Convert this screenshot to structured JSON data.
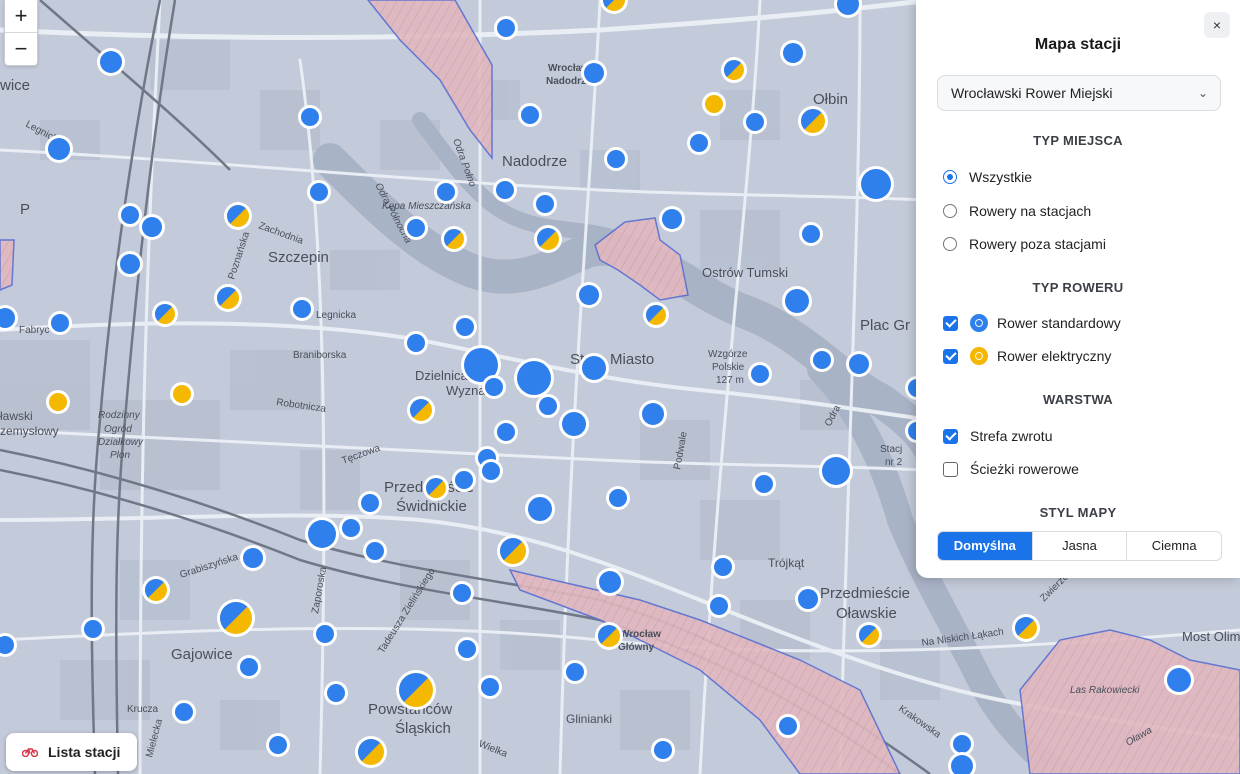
{
  "map": {
    "labels": {
      "szczepin": "Szczepin",
      "nadodrze": "Nadodrze",
      "olbin": "Ołbin",
      "ostrow_tumski": "Ostrów Tumski",
      "kepa": "Kępa Mieszczańska",
      "plac_gr": "Plac Gr",
      "stare_miasto": "Stare Miasto",
      "dzielnica": "Dzielnica",
      "wyznan": "Wyznań",
      "przedmiescie_swidnickie_1": "Przedmieście",
      "przedmiescie_swidnickie_2": "Świdnickie",
      "gajowice": "Gajowice",
      "powstancow_1": "Powstańców",
      "powstancow_2": "Śląskich",
      "przedmiescie_olawskie_1": "Przedmieście",
      "przedmiescie_olawskie_2": "Oławskie",
      "trojkat": "Trójkąt",
      "glinianki": "Glinianki",
      "most_olim": "Most Olim",
      "las_rakowiecki": "Las Rakowiecki",
      "wzgorze_1": "Wzgórze",
      "wzgorze_2": "Polskie",
      "wzgorze_3": "127 m",
      "rodzinny_1": "Rodzinny",
      "rodzinny_2": "Ogród",
      "rodzinny_3": "Działkowy",
      "rodzinny_4": "Plon",
      "wroclaw_nad_1": "Wrocław",
      "wroclaw_nad_2": "Nadodrz",
      "wroclaw_gl_1": "Wrocław",
      "wroclaw_gl_2": "Główny",
      "olawski_1": "ławski",
      "olawski_2": "zemysłowy",
      "wice": "wice",
      "p": "P",
      "legnicka_1": "Legnicka",
      "legnicka_2": "Legnicka",
      "fabryczna": "Fabryc",
      "braniborska": "Braniborska",
      "robotnicza": "Robotnicza",
      "teczowa": "Tęczowa",
      "grabiszynska": "Grabiszyńska",
      "zaporoska": "Zaporoska",
      "zielinskiego": "Tadeusza Zielińskiego",
      "krucza": "Krucza",
      "mielecka": "Mielecka",
      "wielka": "Wielka",
      "zachodnia": "Zachodnia",
      "poznanska": "Poznańska",
      "podwale": "Podwale",
      "na_niskich_lakach": "Na Niskich Łąkach",
      "odra": "Odra",
      "staja": "Stacj",
      "nr2": "nr 2",
      "krakowska": "Krakowska",
      "olawa": "Oława",
      "wzgorze_street": "Wzgórze",
      "zwierzecka": "Zwierzecka",
      "oder_1": "Odra Połno",
      "oder_2": "Odra Północna"
    }
  },
  "zoom": {
    "plus": "+",
    "minus": "−"
  },
  "panel": {
    "title": "Mapa stacji",
    "close": "×",
    "system_select": {
      "value": "Wrocławski Rower Miejski",
      "chevron": "⌄"
    },
    "place_type": {
      "heading": "TYP MIEJSCA",
      "options": [
        {
          "label": "Wszystkie",
          "selected": true
        },
        {
          "label": "Rowery na stacjach",
          "selected": false
        },
        {
          "label": "Rowery poza stacjami",
          "selected": false
        }
      ]
    },
    "bike_type": {
      "heading": "TYP ROWERU",
      "options": [
        {
          "label": "Rower standardowy",
          "checked": true,
          "color": "#2f80ed"
        },
        {
          "label": "Rower elektryczny",
          "checked": true,
          "color": "#f5b800"
        }
      ]
    },
    "layer": {
      "heading": "WARSTWA",
      "options": [
        {
          "label": "Strefa zwrotu",
          "checked": true
        },
        {
          "label": "Ścieżki rowerowe",
          "checked": false
        }
      ]
    },
    "map_style": {
      "heading": "STYL MAPY",
      "options": [
        {
          "label": "Domyślna",
          "active": true
        },
        {
          "label": "Jasna",
          "active": false
        },
        {
          "label": "Ciemna",
          "active": false
        }
      ]
    }
  },
  "station_list_button": {
    "label": "Lista stacji"
  },
  "colors": {
    "standard": "#2f80ed",
    "electric": "#f5b800",
    "return_zone": "#e7b9bd",
    "return_zone_border": "#5a6fd1",
    "accent": "#1a73e8"
  }
}
